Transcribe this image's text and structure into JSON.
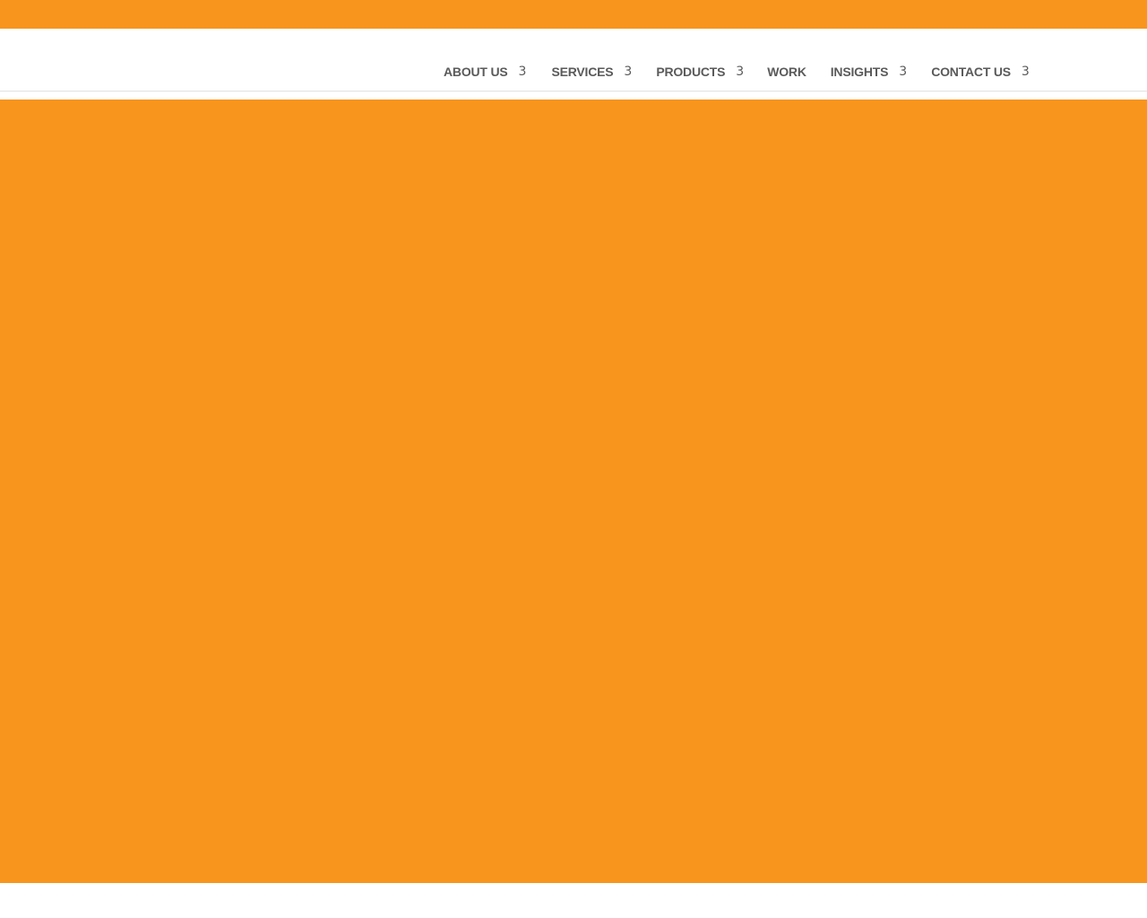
{
  "theme": {
    "accent": "#f7951d",
    "nav_text": "#5a5a5a",
    "header_bg": "#ffffff"
  },
  "nav": {
    "items": [
      {
        "label": "ABOUT US",
        "has_dropdown": true,
        "caret": "3"
      },
      {
        "label": "SERVICES",
        "has_dropdown": true,
        "caret": "3"
      },
      {
        "label": "PRODUCTS",
        "has_dropdown": true,
        "caret": "3"
      },
      {
        "label": "WORK",
        "has_dropdown": false,
        "caret": ""
      },
      {
        "label": "INSIGHTS",
        "has_dropdown": true,
        "caret": "3"
      },
      {
        "label": "CONTACT US",
        "has_dropdown": true,
        "caret": "3"
      }
    ]
  }
}
